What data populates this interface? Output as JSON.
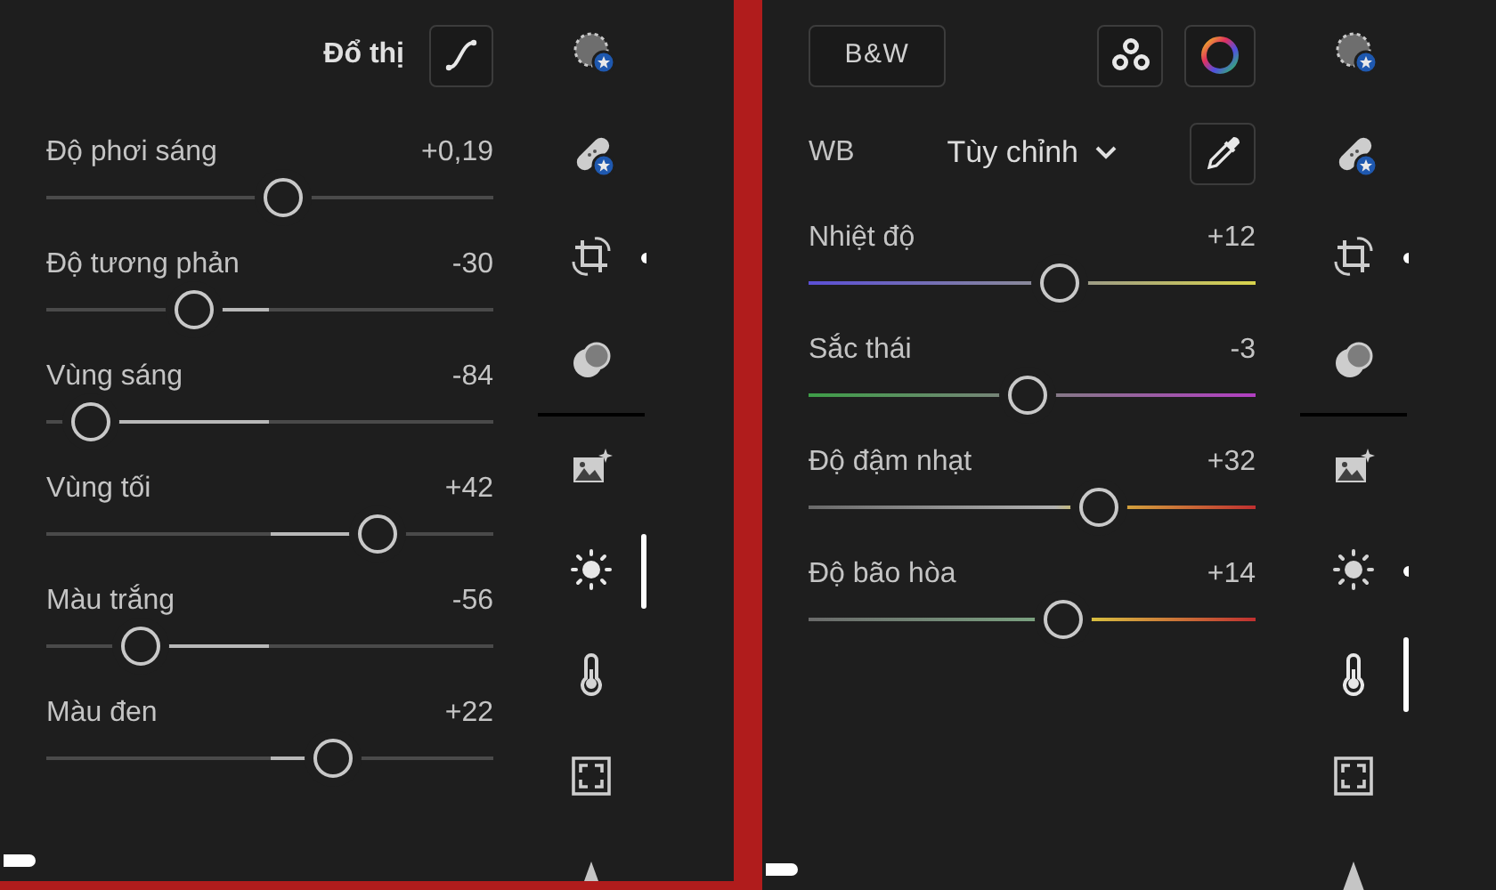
{
  "panels": [
    {
      "header": {
        "kind": "curve",
        "title": "Đổ thị"
      },
      "sliders": [
        {
          "label": "Độ phơi sáng",
          "reading": "+0,19",
          "level": 0.53,
          "kind": "plain"
        },
        {
          "label": "Độ tương phản",
          "reading": "-30",
          "level": 0.33,
          "kind": "plain"
        },
        {
          "label": "Vùng sáng",
          "reading": "-84",
          "level": 0.1,
          "kind": "plain"
        },
        {
          "label": "Vùng tối",
          "reading": "+42",
          "level": 0.74,
          "kind": "plain"
        },
        {
          "label": "Màu trắng",
          "reading": "-56",
          "level": 0.21,
          "kind": "plain"
        },
        {
          "label": "Màu đen",
          "reading": "+22",
          "level": 0.64,
          "kind": "plain"
        }
      ],
      "rail": [
        {
          "selected": false,
          "modified": false
        },
        {
          "selected": false,
          "modified": false
        },
        {
          "selected": false,
          "modified": true
        },
        {
          "selected": false,
          "modified": false
        },
        {
          "selected": false,
          "modified": false
        },
        {
          "selected": true,
          "modified": false
        },
        {
          "selected": false,
          "modified": false
        },
        {
          "selected": false,
          "modified": false
        },
        {
          "selected": false,
          "modified": false
        }
      ]
    },
    {
      "header": {
        "kind": "white_balance",
        "bw_button": "B&W",
        "wb_label": "WB",
        "wb_value": "Tùy chỉnh"
      },
      "sliders": [
        {
          "label": "Nhiệt độ",
          "reading": "+12",
          "level": 0.56,
          "kind": "temperature"
        },
        {
          "label": "Sắc thái",
          "reading": "-3",
          "level": 0.49,
          "kind": "tint"
        },
        {
          "label": "Độ đậm nhạt",
          "reading": "+32",
          "level": 0.65,
          "kind": "vibrance"
        },
        {
          "label": "Độ bão hòa",
          "reading": "+14",
          "level": 0.57,
          "kind": "saturation"
        }
      ],
      "rail": [
        {
          "selected": false,
          "modified": false
        },
        {
          "selected": false,
          "modified": false
        },
        {
          "selected": false,
          "modified": true
        },
        {
          "selected": false,
          "modified": false
        },
        {
          "selected": false,
          "modified": false
        },
        {
          "selected": false,
          "modified": true
        },
        {
          "selected": true,
          "modified": false
        },
        {
          "selected": false,
          "modified": false
        },
        {
          "selected": false,
          "modified": false
        }
      ]
    }
  ]
}
